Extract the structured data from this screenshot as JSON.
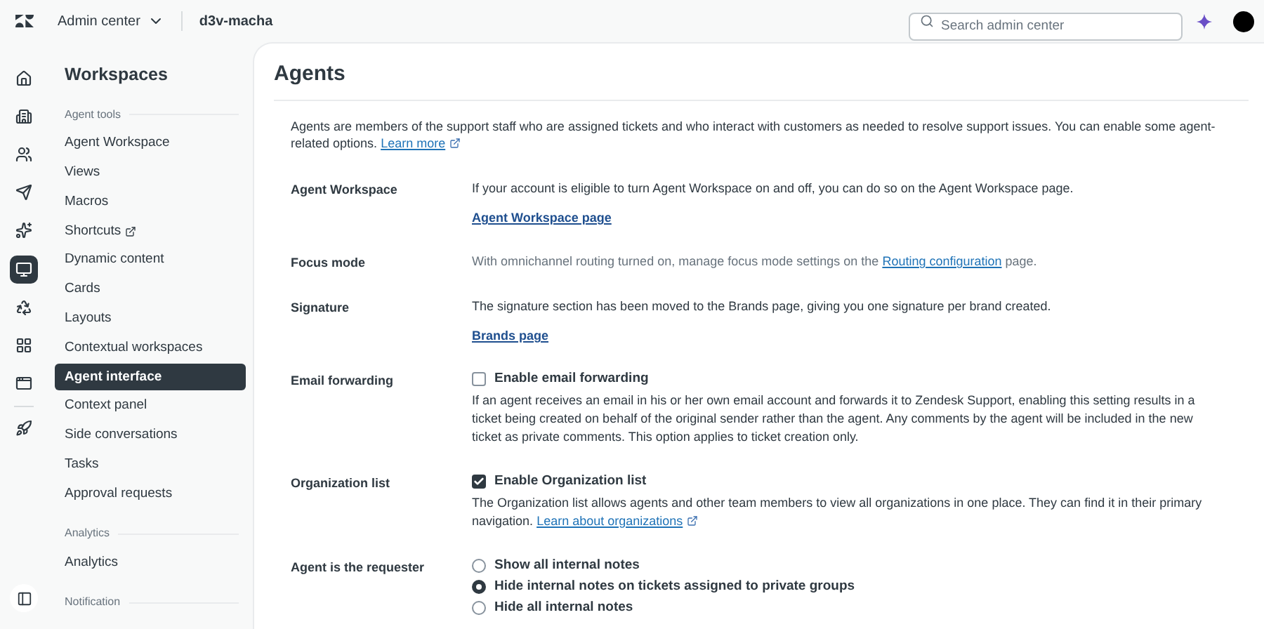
{
  "topbar": {
    "product": "Admin center",
    "account": "d3v-macha",
    "search": {
      "placeholder": "Search admin center"
    }
  },
  "rail": [
    {
      "selected": false
    },
    {
      "selected": false
    },
    {
      "selected": false
    },
    {
      "selected": false
    },
    {
      "selected": false
    },
    {
      "selected": true
    },
    {
      "selected": false
    },
    {
      "selected": false
    },
    {
      "selected": false
    },
    {
      "selected": false
    }
  ],
  "sidebar": {
    "title": "Workspaces",
    "sections": [
      {
        "heading": "Agent tools",
        "items": [
          {
            "label": "Agent Workspace",
            "selected": false,
            "external": false
          },
          {
            "label": "Views",
            "selected": false,
            "external": false
          },
          {
            "label": "Macros",
            "selected": false,
            "external": false
          },
          {
            "label": "Shortcuts",
            "selected": false,
            "external": true
          },
          {
            "label": "Dynamic content",
            "selected": false,
            "external": false
          },
          {
            "label": "Cards",
            "selected": false,
            "external": false
          },
          {
            "label": "Layouts",
            "selected": false,
            "external": false
          },
          {
            "label": "Contextual workspaces",
            "selected": false,
            "external": false
          },
          {
            "label": "Agent interface",
            "selected": true,
            "external": false
          },
          {
            "label": "Context panel",
            "selected": false,
            "external": false
          },
          {
            "label": "Side conversations",
            "selected": false,
            "external": false
          },
          {
            "label": "Tasks",
            "selected": false,
            "external": false
          },
          {
            "label": "Approval requests",
            "selected": false,
            "external": false
          }
        ]
      },
      {
        "heading": "Analytics",
        "items": [
          {
            "label": "Analytics",
            "selected": false,
            "external": false
          }
        ]
      },
      {
        "heading": "Notification"
      }
    ]
  },
  "page": {
    "title": "Agents",
    "intro": {
      "text": "Agents are members of the support staff who are assigned tickets and who interact with customers as needed to resolve support issues. You can enable some agent-related options.",
      "link": "Learn more"
    },
    "settings": [
      {
        "label": "Agent Workspace",
        "kind": "text",
        "text": "If your account is eligible to turn Agent Workspace on and off, you can do so on the Agent Workspace page.",
        "link": "Agent Workspace page"
      },
      {
        "label": "Focus mode",
        "kind": "inline_link",
        "text_before": "With omnichannel routing turned on, manage focus mode settings on the",
        "link": "Routing configuration",
        "text_after": "page."
      },
      {
        "label": "Signature",
        "kind": "text",
        "text": "The signature section has been moved to the Brands page, giving you one signature per brand created.",
        "link": "Brands page"
      },
      {
        "label": "Email forwarding",
        "kind": "checkbox",
        "option": "Enable email forwarding",
        "checked": false,
        "description": "If an agent receives an email in his or her own email account and forwards it to Zendesk Support, enabling this setting results in a ticket being created on behalf of the original sender rather than the agent. Any comments by the agent will be included in the new ticket as private comments. This option applies to ticket creation only."
      },
      {
        "label": "Organization list",
        "kind": "checkbox",
        "option": "Enable Organization list",
        "checked": true,
        "description": "The Organization list allows agents and other team members to view all organizations in one place. They can find it in their primary navigation.",
        "link": "Learn about organizations"
      },
      {
        "label": "Agent is the requester",
        "kind": "radio",
        "options": [
          {
            "label": "Show all internal notes",
            "selected": false
          },
          {
            "label": "Hide internal notes on tickets assigned to private groups",
            "selected": true
          },
          {
            "label": "Hide all internal notes",
            "selected": false
          }
        ]
      }
    ]
  }
}
